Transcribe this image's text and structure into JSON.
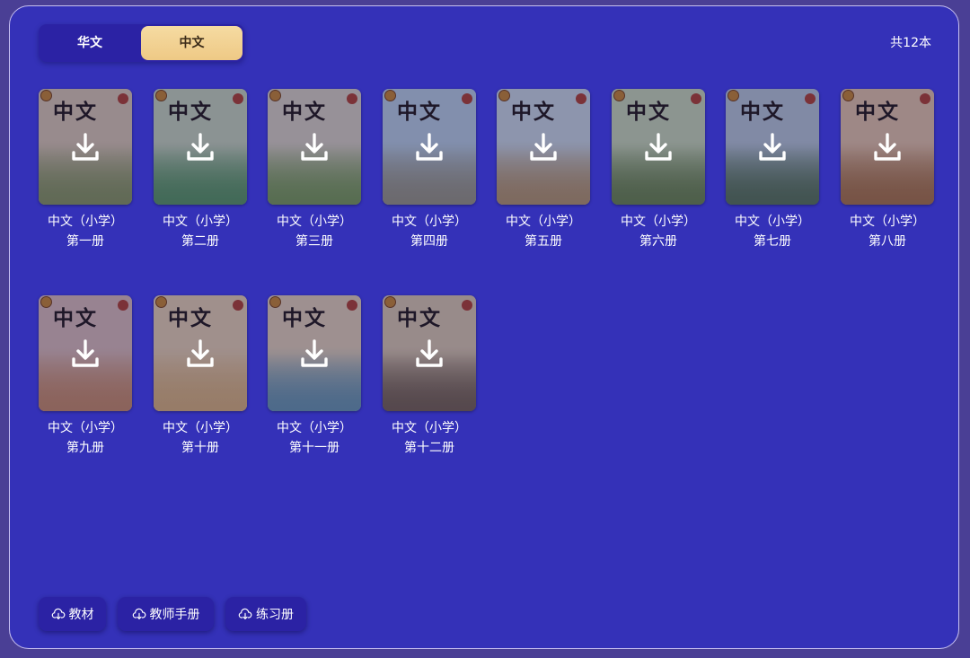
{
  "tabs": [
    {
      "label": "华文",
      "active": false
    },
    {
      "label": "中文",
      "active": true
    }
  ],
  "total_label": "共12本",
  "cover_title": "中文",
  "books": [
    {
      "series": "中文（小学）",
      "volume": "第一册",
      "sky": "#c9b9a4",
      "ground": "#7a8a55"
    },
    {
      "series": "中文（小学）",
      "volume": "第二册",
      "sky": "#b7c4ad",
      "ground": "#4f8a58"
    },
    {
      "series": "中文（小学）",
      "volume": "第三册",
      "sky": "#c8c2b4",
      "ground": "#6d8f4f"
    },
    {
      "series": "中文（小学）",
      "volume": "第四册",
      "sky": "#a9bfd2",
      "ground": "#8a8a78"
    },
    {
      "series": "中文（小学）",
      "volume": "第五册",
      "sky": "#b9c7d1",
      "ground": "#a48a62"
    },
    {
      "series": "中文（小学）",
      "volume": "第六册",
      "sky": "#b8c8a8",
      "ground": "#5f7a45"
    },
    {
      "series": "中文（小学）",
      "volume": "第七册",
      "sky": "#a8b8c6",
      "ground": "#4e6a4e"
    },
    {
      "series": "中文（小学）",
      "volume": "第八册",
      "sky": "#d2b59a",
      "ground": "#9a6a3e"
    },
    {
      "series": "中文（小学）",
      "volume": "第九册",
      "sky": "#c9aeaa",
      "ground": "#b7805d"
    },
    {
      "series": "中文（小学）",
      "volume": "第十册",
      "sky": "#d4c0a2",
      "ground": "#c8a46f"
    },
    {
      "series": "中文（小学）",
      "volume": "第十一册",
      "sky": "#d1c1a8",
      "ground": "#5e8aa0"
    },
    {
      "series": "中文（小学）",
      "volume": "第十二册",
      "sky": "#c9b9a0",
      "ground": "#6a5a48"
    }
  ],
  "actions": [
    {
      "label": "教材",
      "icon": "cloud-download-icon"
    },
    {
      "label": "教师手册",
      "icon": "cloud-download-icon"
    },
    {
      "label": "练习册",
      "icon": "cloud-download-icon"
    }
  ],
  "colors": {
    "background": "#3431b8",
    "tab_active": "#f2d08f",
    "button": "#2b22a4"
  }
}
